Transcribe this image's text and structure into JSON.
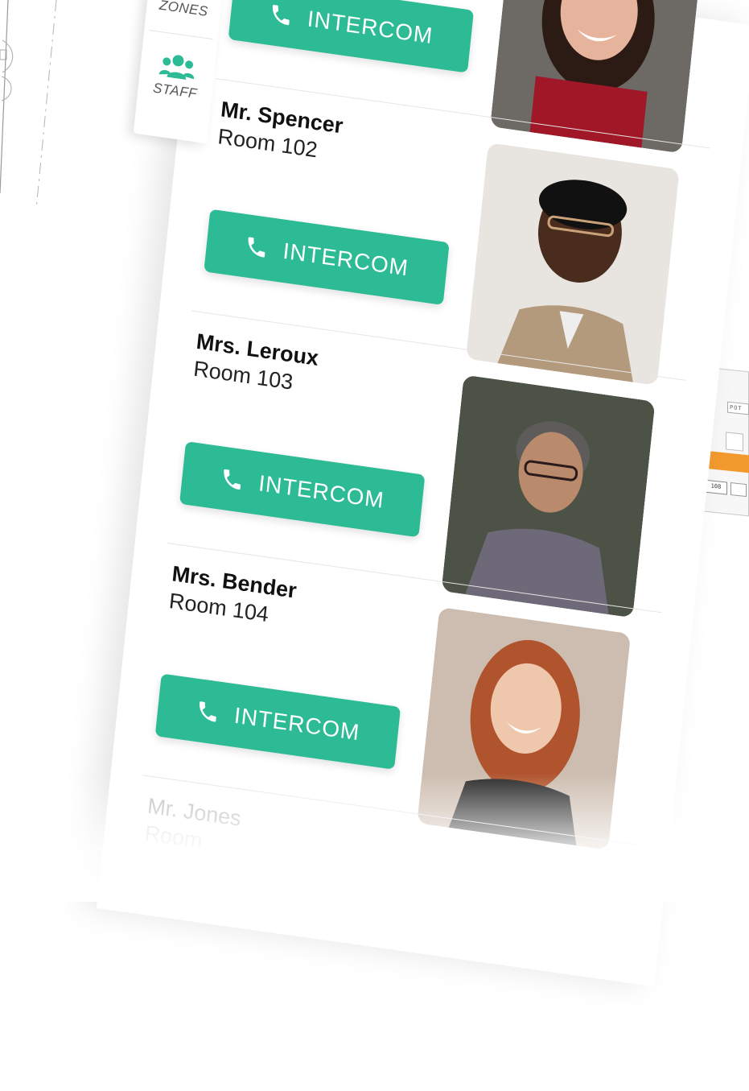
{
  "tabs": [
    {
      "label": "ZONES",
      "icon": "grid-icon"
    },
    {
      "label": "STAFF",
      "icon": "people-icon"
    }
  ],
  "button_label": "INTERCOM",
  "accent": "#2dbb96",
  "staff": [
    {
      "name": "Mr. Spencer",
      "room": "Room 102"
    },
    {
      "name": "Mrs. Leroux",
      "room": "Room 103"
    },
    {
      "name": "Mrs. Bender",
      "room": "Room 104"
    },
    {
      "name": "Mr. Jones",
      "room": "Room"
    }
  ],
  "floorplan": {
    "label": "POT",
    "room": "108"
  }
}
